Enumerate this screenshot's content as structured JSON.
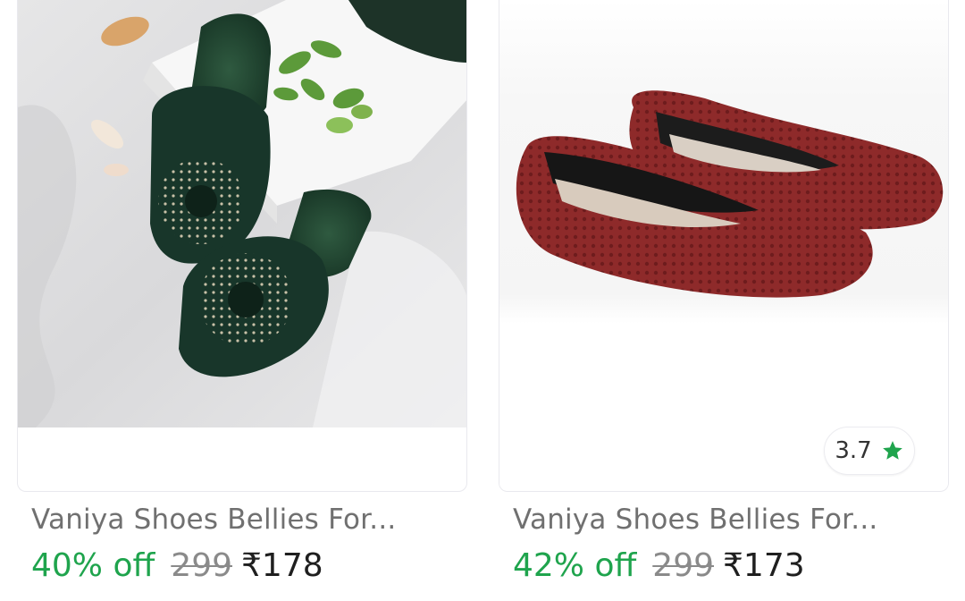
{
  "products": [
    {
      "title": "Vaniya Shoes Bellies For...",
      "discount": "40% off",
      "mrp": "299",
      "price": "₹178",
      "image": "green-embellished-mules",
      "colors": {
        "product": "#1f3d2c",
        "beads": "#c9c1a8"
      }
    },
    {
      "title": "Vaniya Shoes Bellies For...",
      "discount": "42% off",
      "mrp": "299",
      "price": "₹173",
      "rating": "3.7",
      "rating_icon": "star-icon",
      "image": "maroon-perforated-bellies",
      "colors": {
        "product": "#8e2a2a",
        "rating_star": "#1fa44d"
      }
    }
  ],
  "colors": {
    "discount": "#1fa44d",
    "title": "#707070",
    "mrp": "#8a8a8a",
    "price": "#1f1f1f"
  }
}
